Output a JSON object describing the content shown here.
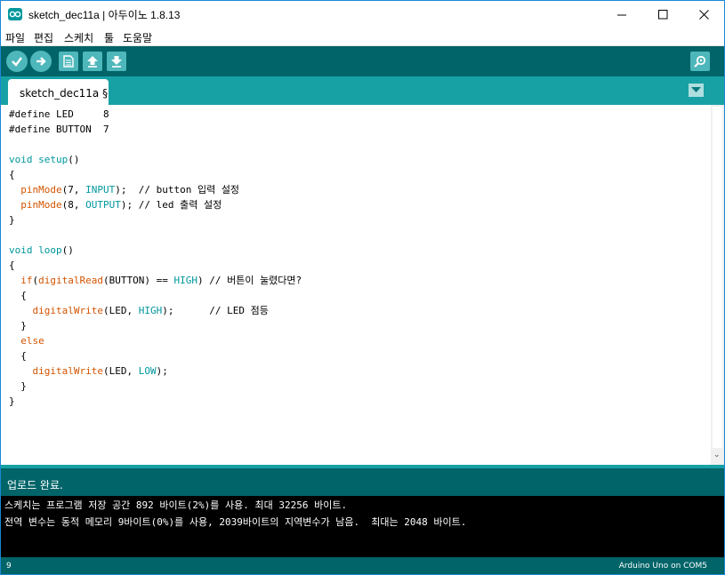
{
  "window": {
    "title": "sketch_dec11a | 아두이노 1.8.13",
    "icons": [
      "arduino-logo-icon",
      "minimize-icon",
      "maximize-icon",
      "close-icon"
    ]
  },
  "menu": {
    "items": [
      "파일",
      "편집",
      "스케치",
      "툴",
      "도움말"
    ]
  },
  "toolbar": {
    "icons": [
      "verify-icon",
      "upload-icon",
      "new-icon",
      "open-icon",
      "save-icon",
      "serial-monitor-icon"
    ]
  },
  "tabs": {
    "active_label": "sketch_dec11a §"
  },
  "editor": {
    "lines": [
      [
        {
          "t": "#define LED     8",
          "c": "p"
        }
      ],
      [
        {
          "t": "#define BUTTON  7",
          "c": "p"
        }
      ],
      [],
      [
        {
          "t": "void",
          "c": "k"
        },
        {
          "t": " ",
          "c": "p"
        },
        {
          "t": "setup",
          "c": "k"
        },
        {
          "t": "()",
          "c": "p"
        }
      ],
      [
        {
          "t": "{",
          "c": "p"
        }
      ],
      [
        {
          "t": "  ",
          "c": "p"
        },
        {
          "t": "pinMode",
          "c": "f"
        },
        {
          "t": "(7, ",
          "c": "p"
        },
        {
          "t": "INPUT",
          "c": "c"
        },
        {
          "t": ");  // button 입력 설정",
          "c": "p"
        }
      ],
      [
        {
          "t": "  ",
          "c": "p"
        },
        {
          "t": "pinMode",
          "c": "f"
        },
        {
          "t": "(8, ",
          "c": "p"
        },
        {
          "t": "OUTPUT",
          "c": "c"
        },
        {
          "t": "); // led 출력 설정",
          "c": "p"
        }
      ],
      [
        {
          "t": "}",
          "c": "p"
        }
      ],
      [],
      [
        {
          "t": "void",
          "c": "k"
        },
        {
          "t": " ",
          "c": "p"
        },
        {
          "t": "loop",
          "c": "k"
        },
        {
          "t": "()",
          "c": "p"
        }
      ],
      [
        {
          "t": "{",
          "c": "p"
        }
      ],
      [
        {
          "t": "  ",
          "c": "p"
        },
        {
          "t": "if",
          "c": "f"
        },
        {
          "t": "(",
          "c": "p"
        },
        {
          "t": "digitalRead",
          "c": "f"
        },
        {
          "t": "(BUTTON) == ",
          "c": "p"
        },
        {
          "t": "HIGH",
          "c": "c"
        },
        {
          "t": ") // 버튼이 눌렸다면?",
          "c": "p"
        }
      ],
      [
        {
          "t": "  {",
          "c": "p"
        }
      ],
      [
        {
          "t": "    ",
          "c": "p"
        },
        {
          "t": "digitalWrite",
          "c": "f"
        },
        {
          "t": "(LED, ",
          "c": "p"
        },
        {
          "t": "HIGH",
          "c": "c"
        },
        {
          "t": ");      // LED 점등",
          "c": "p"
        }
      ],
      [
        {
          "t": "  }",
          "c": "p"
        }
      ],
      [
        {
          "t": "  ",
          "c": "p"
        },
        {
          "t": "else",
          "c": "f"
        }
      ],
      [
        {
          "t": "  {",
          "c": "p"
        }
      ],
      [
        {
          "t": "    ",
          "c": "p"
        },
        {
          "t": "digitalWrite",
          "c": "f"
        },
        {
          "t": "(LED, ",
          "c": "p"
        },
        {
          "t": "LOW",
          "c": "c"
        },
        {
          "t": ");",
          "c": "p"
        }
      ],
      [
        {
          "t": "  }",
          "c": "p"
        }
      ],
      [
        {
          "t": "}",
          "c": "p"
        }
      ]
    ]
  },
  "syntax_colors": {
    "k": "#00979c",
    "f": "#d35400",
    "c": "#00979c",
    "p": "#000000"
  },
  "status": {
    "message": "업로드 완료."
  },
  "console": {
    "lines": [
      "스케치는 프로그램 저장 공간 892 바이트(2%)를 사용. 최대 32256 바이트.",
      "전역 변수는 동적 메모리 9바이트(0%)를 사용, 2039바이트의 지역변수가 남음.  최대는 2048 바이트."
    ]
  },
  "footer": {
    "line_number": "9",
    "board": "Arduino Uno on COM5"
  },
  "colors": {
    "toolbar": "#006468",
    "tab_row": "#17a1a5",
    "console_bg": "#000000"
  }
}
